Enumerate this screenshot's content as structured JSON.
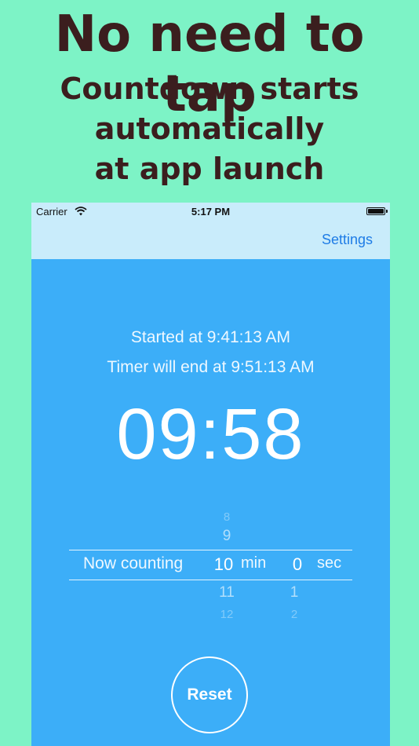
{
  "banner": {
    "headline": "No need to tap",
    "subhead_line1": "Countdown starts",
    "subhead_line2": "automatically",
    "subhead_line3": "at app launch"
  },
  "statusbar": {
    "carrier": "Carrier",
    "time": "5:17 PM",
    "wifi_icon": "wifi-icon",
    "battery_icon": "battery-icon"
  },
  "navbar": {
    "settings_label": "Settings"
  },
  "timer": {
    "started_text": "Started at 9:41:13 AM",
    "ends_text": "Timer will end at 9:51:13 AM",
    "remaining": "09:58"
  },
  "picker": {
    "label_now": "Now counting",
    "label_min": "min",
    "label_sec": "sec",
    "minutes": {
      "above2": "8",
      "above1": "9",
      "selected": "10",
      "below1": "11",
      "below2": "12"
    },
    "seconds": {
      "selected": "0",
      "below1": "1",
      "below2": "2"
    }
  },
  "reset_label": "Reset",
  "colors": {
    "background": "#7df3c6",
    "headline": "#3b1e1e",
    "app_background": "#3caef8",
    "navbar_background": "#c9ecfb",
    "accent_link": "#1e7ce6"
  }
}
